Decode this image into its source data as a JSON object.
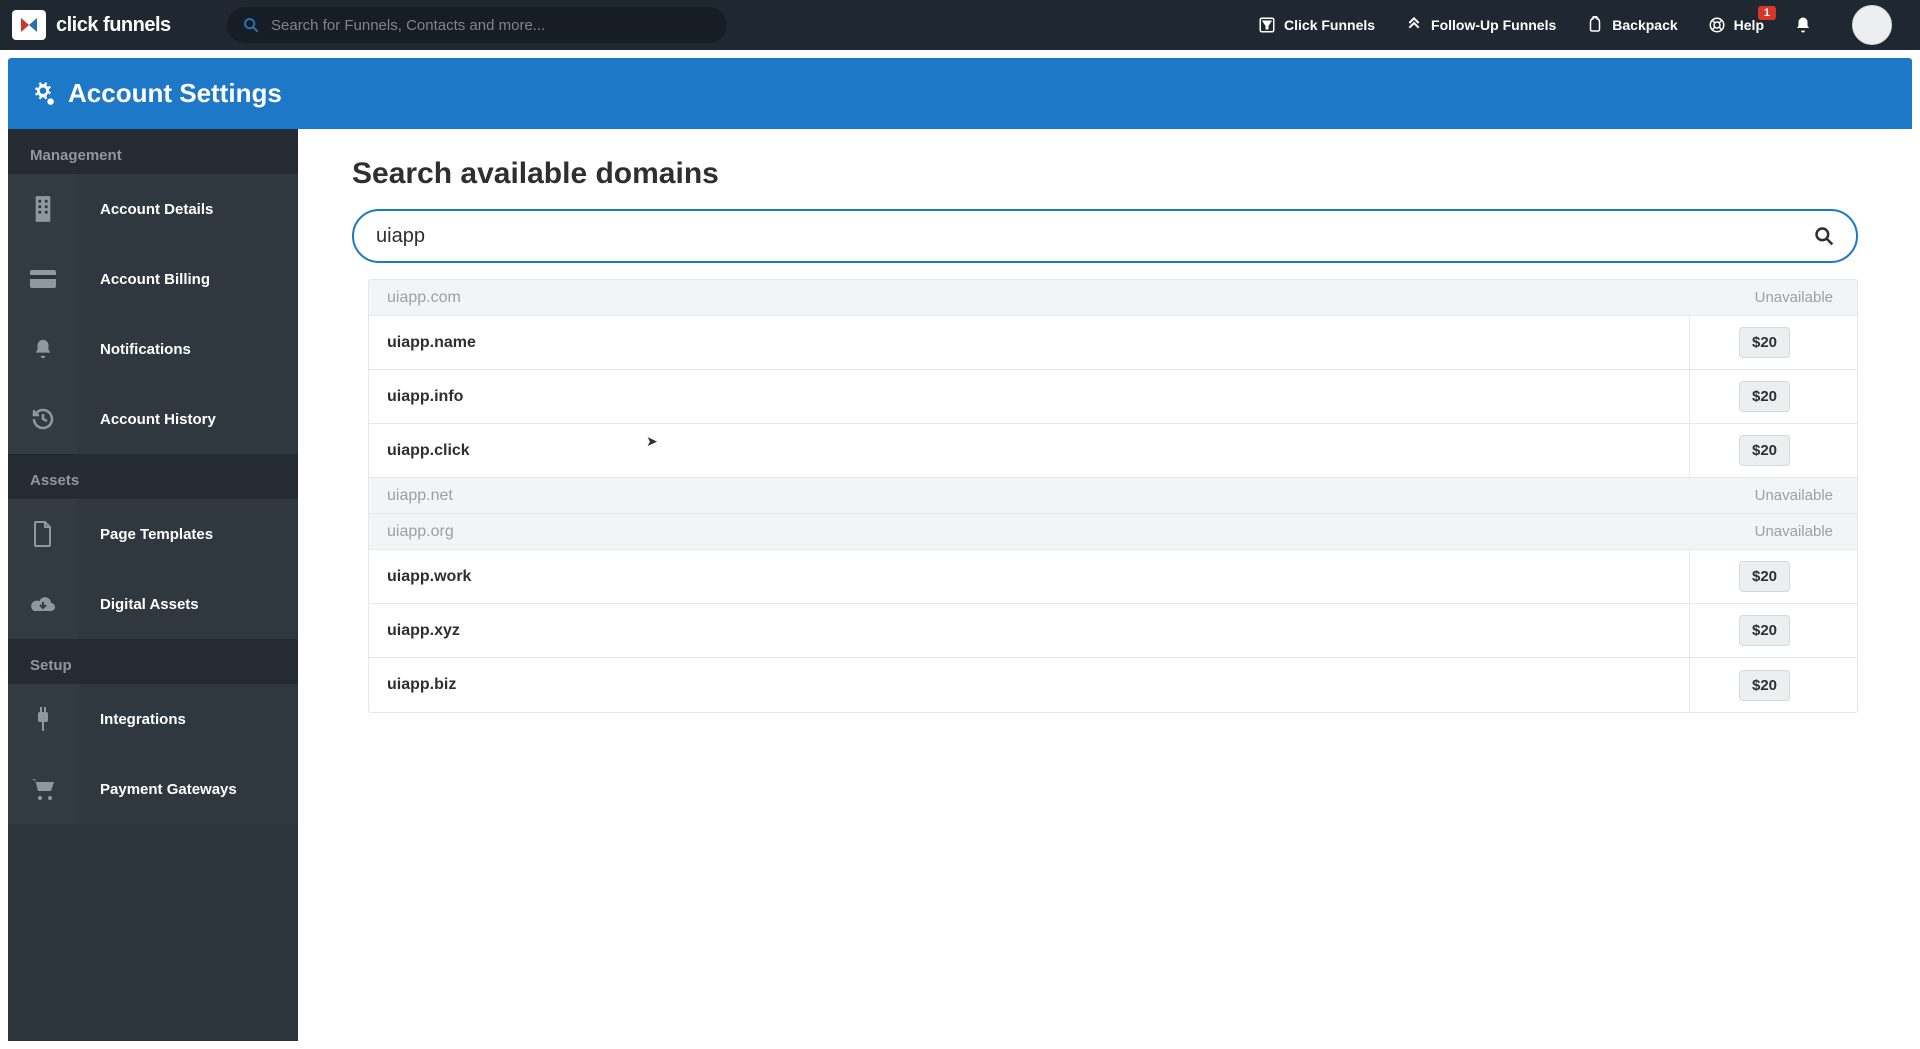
{
  "brand": "click funnels",
  "topnav": {
    "search_placeholder": "Search for Funnels, Contacts and more...",
    "links": {
      "clickfunnels": "Click Funnels",
      "followup": "Follow-Up Funnels",
      "backpack": "Backpack",
      "help": "Help",
      "help_badge": "1"
    }
  },
  "page_title": "Account Settings",
  "sidebar": {
    "sections": {
      "management": "Management",
      "assets": "Assets",
      "setup": "Setup"
    },
    "items": {
      "account_details": "Account Details",
      "account_billing": "Account Billing",
      "notifications": "Notifications",
      "account_history": "Account History",
      "page_templates": "Page Templates",
      "digital_assets": "Digital Assets",
      "integrations": "Integrations",
      "payment_gateways": "Payment Gateways"
    }
  },
  "main": {
    "heading": "Search available domains",
    "search_value": "uiapp",
    "unavailable_label": "Unavailable",
    "results": [
      {
        "domain": "uiapp.com",
        "available": false
      },
      {
        "domain": "uiapp.name",
        "available": true,
        "price": "$20"
      },
      {
        "domain": "uiapp.info",
        "available": true,
        "price": "$20"
      },
      {
        "domain": "uiapp.click",
        "available": true,
        "price": "$20"
      },
      {
        "domain": "uiapp.net",
        "available": false
      },
      {
        "domain": "uiapp.org",
        "available": false
      },
      {
        "domain": "uiapp.work",
        "available": true,
        "price": "$20"
      },
      {
        "domain": "uiapp.xyz",
        "available": true,
        "price": "$20"
      },
      {
        "domain": "uiapp.biz",
        "available": true,
        "price": "$20"
      }
    ]
  }
}
